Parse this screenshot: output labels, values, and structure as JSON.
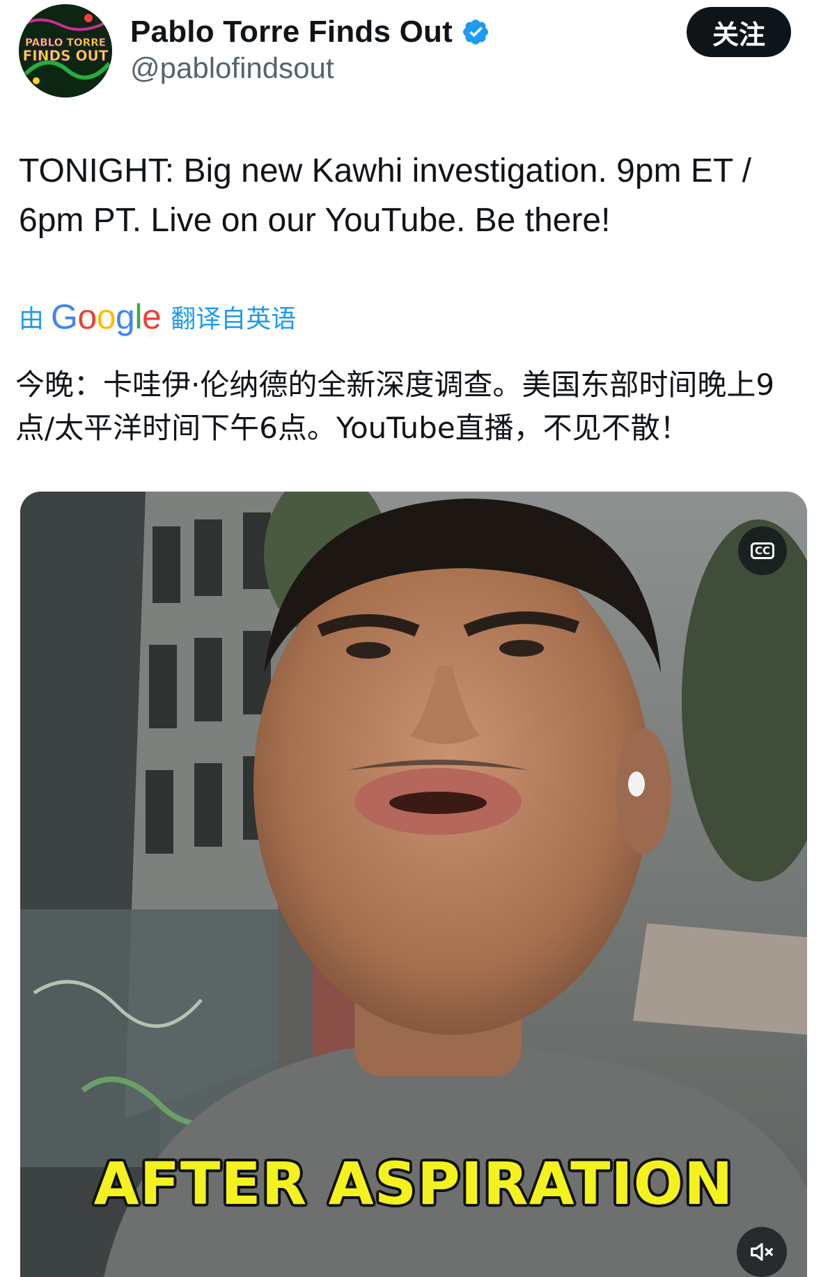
{
  "author": {
    "display_name": "Pablo Torre Finds Out",
    "handle": "@pablofindsout",
    "verified": true,
    "avatar_lines": [
      "PABLO TORRE",
      "FINDS OUT"
    ]
  },
  "follow_button": {
    "label": "关注"
  },
  "tweet": {
    "text": "TONIGHT: Big new Kawhi investigation. 9pm ET / 6pm PT. Live on our YouTube. Be there!"
  },
  "translation": {
    "prefix": "由",
    "provider": "Google",
    "suffix": "翻译自英语",
    "text": "今晚：卡哇伊·伦纳德的全新深度调查。美国东部时间晚上9点/太平洋时间下午6点。YouTube直播，不见不散！"
  },
  "video": {
    "caption": "AFTER ASPIRATION",
    "cc_label": "CC",
    "cc_icon": "closed-captions-icon",
    "mute_icon": "speaker-muted-icon"
  },
  "colors": {
    "accent": "#1d9bf0",
    "text": "#0f1419",
    "secondary": "#536471",
    "button_bg": "#0f1419",
    "caption_yellow": "#f3f21e"
  }
}
